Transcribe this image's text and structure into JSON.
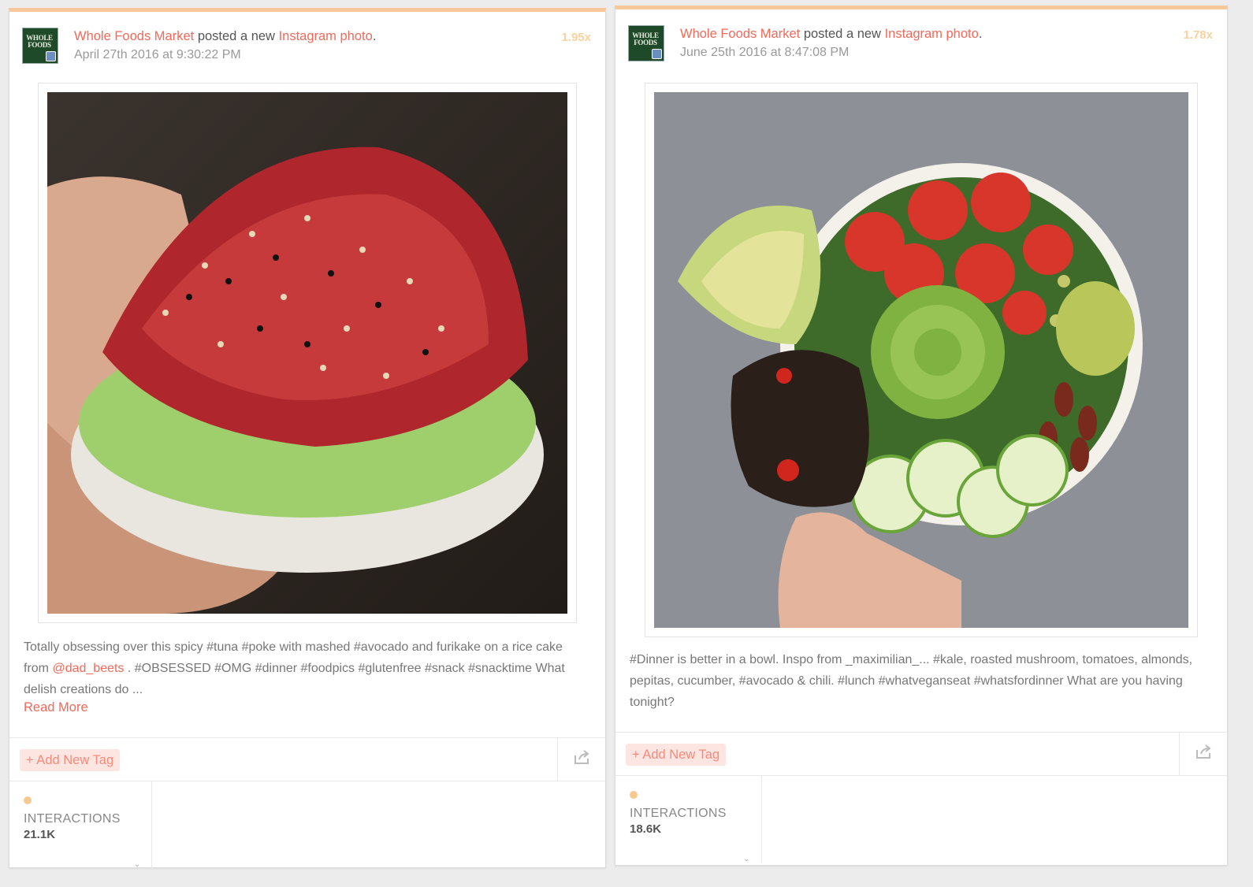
{
  "posts": [
    {
      "author": "Whole Foods Market",
      "action": " posted a new ",
      "network_link": "Instagram photo",
      "period": ".",
      "timestamp": "April 27th 2016 at 9:30:22 PM",
      "multiplier": "1.95x",
      "avatar_text": "WHOLE FOODS",
      "caption_before_mention": "Totally obsessing over this spicy #tuna #poke with mashed #avocado and furikake on a rice cake from ",
      "caption_mention": "@dad_beets",
      "caption_after_mention": " . #OBSESSED #OMG #dinner #foodpics #glutenfree #snack #snacktime What delish creations do ...",
      "read_more": "Read More",
      "add_tag": "+ Add New Tag",
      "metric_label": "INTERACTIONS",
      "metric_value": "21.1K",
      "chevron": "⌄"
    },
    {
      "author": "Whole Foods Market",
      "action": " posted a new ",
      "network_link": "Instagram photo",
      "period": ".",
      "timestamp": "June 25th 2016 at 8:47:08 PM",
      "multiplier": "1.78x",
      "avatar_text": "WHOLE FOODS",
      "caption": "#Dinner is better in a bowl. Inspo from _maximilian_... #kale, roasted mushroom, tomatoes, almonds, pepitas, cucumber, #avocado & chili. #lunch #whatveganseat #whatsfordinner What are you having tonight?",
      "add_tag": "+ Add New Tag",
      "metric_label": "INTERACTIONS",
      "metric_value": "18.6K",
      "chevron": "⌄"
    }
  ],
  "colors": {
    "accent": "#f06a5b",
    "card_top_border": "#f7c79b",
    "multiplier": "#f8d29f",
    "tag_bg": "#fde5e1"
  },
  "icons": [
    "whole-foods-logo-avatar",
    "instagram-badge-icon",
    "share-icon",
    "chevron-down-icon"
  ]
}
